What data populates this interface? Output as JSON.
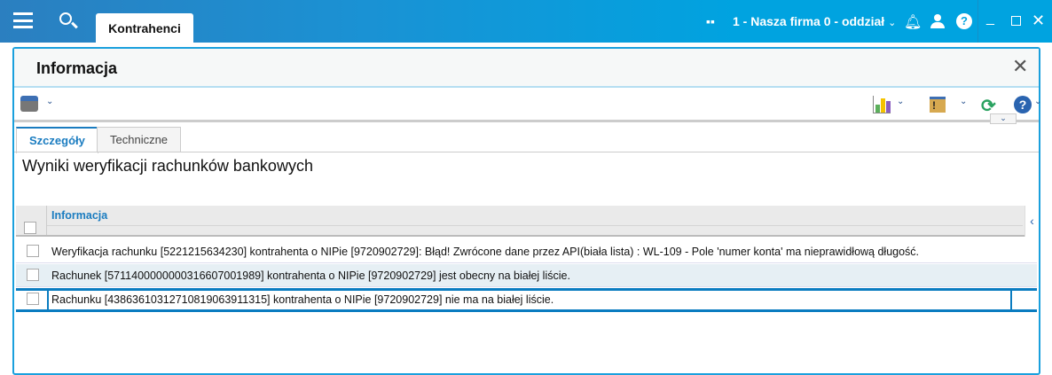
{
  "topbar": {
    "tab": "Kontrahenci",
    "company": "1 - Nasza firma 0 - oddział"
  },
  "modal": {
    "title": "Informacja",
    "tabs": [
      "Szczegóły",
      "Techniczne"
    ],
    "heading": "Wyniki weryfikacji rachunków bankowych",
    "grid": {
      "column": "Informacja",
      "rows": [
        "Weryfikacja rachunku [5221215634230] kontrahenta o NIPie [9720902729]: Błąd! Zwrócone dane przez API(biała lista) : WL-109 - Pole 'numer konta' ma nieprawidłową długość.",
        "Rachunek [57114000000003166070​01989] kontrahenta o NIPie [9720902729] jest obecny na białej liście.",
        "Rachunku [43863610312710819063911315] kontrahenta o NIPie [9720902729] nie ma na białej liście."
      ]
    }
  },
  "colors": {
    "accent": "#00a3e0",
    "selected": "#0a7cc0",
    "link": "#1a7cc0"
  }
}
